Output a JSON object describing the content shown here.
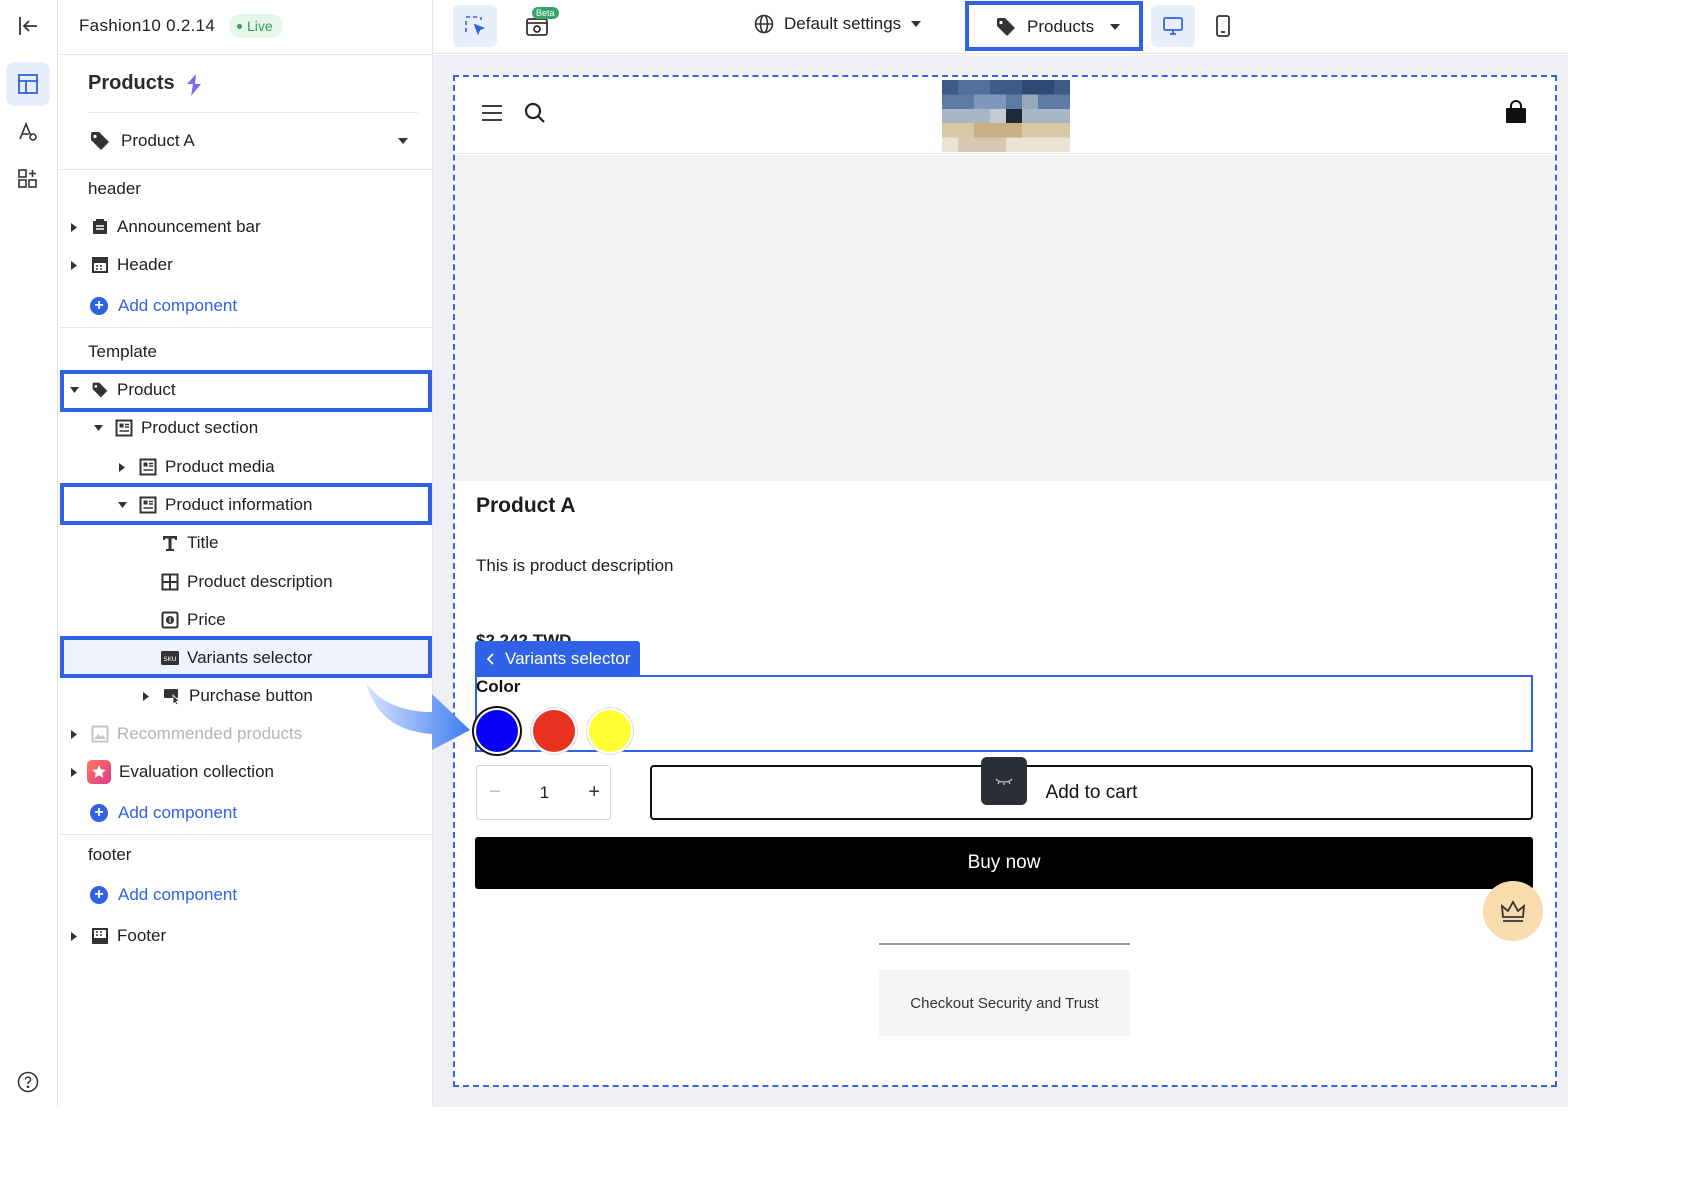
{
  "app": {
    "title": "Fashion10 0.2.14",
    "status": "Live",
    "beta_label": "Beta"
  },
  "topbar": {
    "settings_label": "Default settings",
    "page_type_label": "Products"
  },
  "sidebar": {
    "section_title": "Products",
    "product_select": "Product A",
    "groups": {
      "header": "header",
      "template": "Template",
      "footer": "footer"
    },
    "add_component": "Add component",
    "header_items": [
      "Announcement bar",
      "Header"
    ],
    "template_items": {
      "product": "Product",
      "product_section": "Product section",
      "product_media": "Product media",
      "product_information": "Product information",
      "title": "Title",
      "product_description": "Product description",
      "price": "Price",
      "variants_selector": "Variants selector",
      "purchase_button": "Purchase button",
      "recommended_products": "Recommended products",
      "evaluation_collection": "Evaluation collection"
    },
    "footer_items": [
      "Footer"
    ]
  },
  "preview": {
    "product_title": "Product A",
    "product_description": "This is product description",
    "price": "$2,242 TWD",
    "selected_block_label": "Variants selector",
    "variant_option_label": "Color",
    "swatches": [
      {
        "name": "blue",
        "color": "#0a00f5",
        "selected": true
      },
      {
        "name": "red",
        "color": "#e8321f",
        "selected": false
      },
      {
        "name": "yellow",
        "color": "#ffff33",
        "selected": false
      }
    ],
    "quantity": "1",
    "add_to_cart": "Add to cart",
    "buy_now": "Buy now",
    "trust_text": "Checkout Security and Trust"
  },
  "colors": {
    "accent": "#2f62e6",
    "live_bg": "#e5f6ea",
    "live_text": "#3a9a5b"
  }
}
